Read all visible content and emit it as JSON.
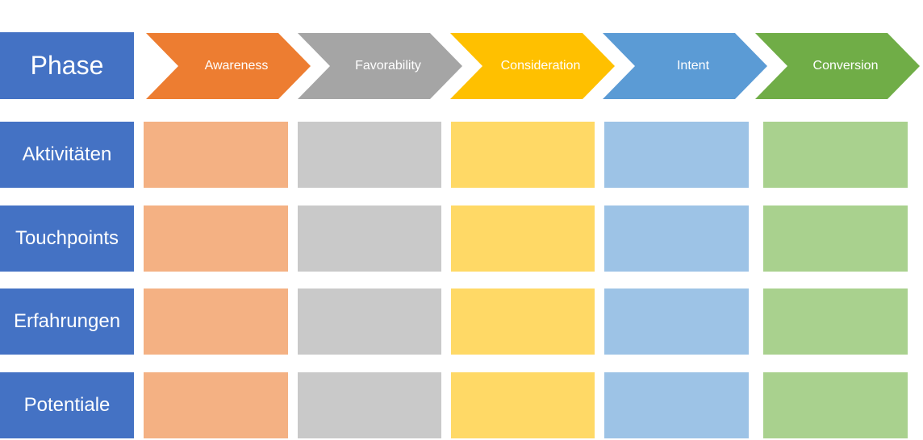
{
  "header": {
    "label": "Phase"
  },
  "phases": [
    {
      "label": "Awareness",
      "color": "#ED7D31",
      "light": "#F4B183"
    },
    {
      "label": "Favorability",
      "color": "#A5A5A5",
      "light": "#C9C9C9"
    },
    {
      "label": "Consideration",
      "color": "#FFC000",
      "light": "#FFD966"
    },
    {
      "label": "Intent",
      "color": "#5B9BD5",
      "light": "#9DC3E6"
    },
    {
      "label": "Conversion",
      "color": "#70AD47",
      "light": "#A9D18E"
    }
  ],
  "rows": [
    {
      "label": "Aktivitäten"
    },
    {
      "label": "Touchpoints"
    },
    {
      "label": "Erfahrungen"
    },
    {
      "label": "Potentiale"
    }
  ],
  "label_color": "#4472C4"
}
